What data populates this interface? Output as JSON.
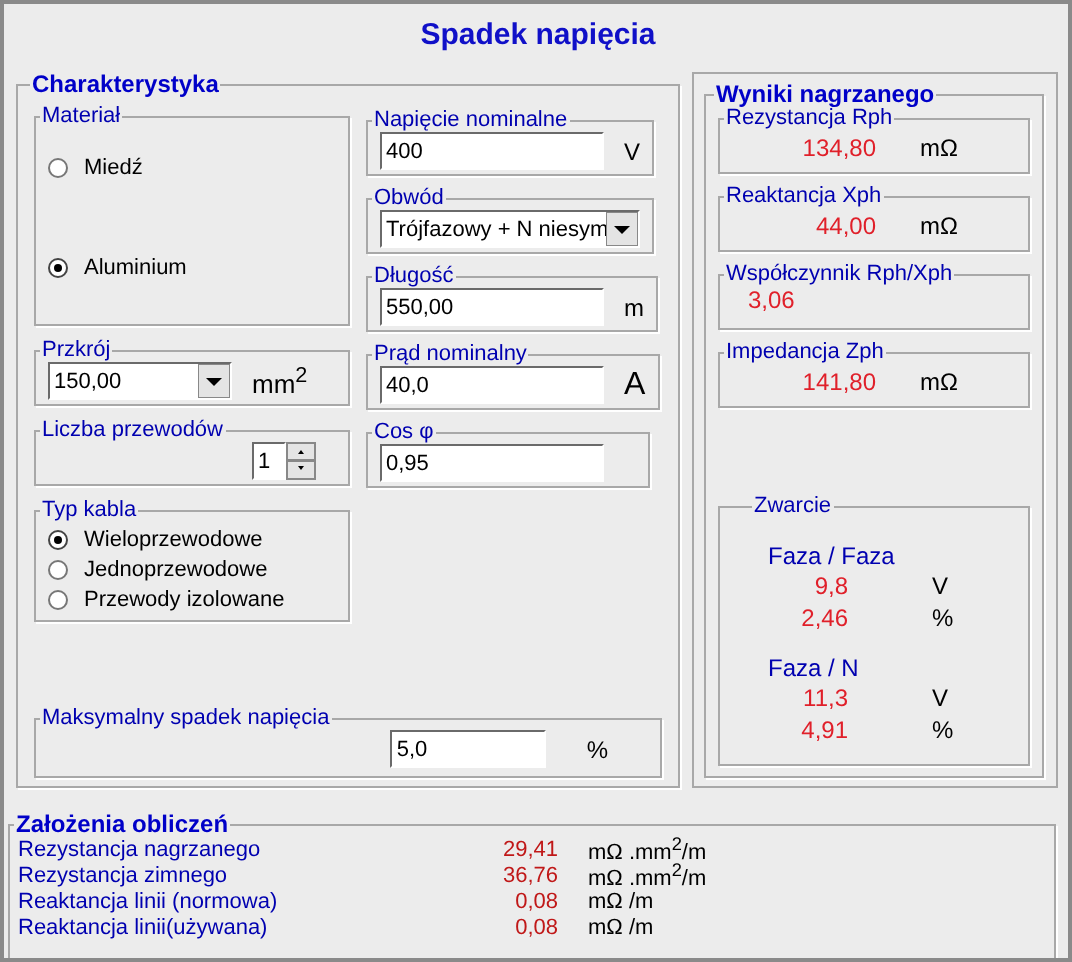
{
  "title": "Spadek napięcia",
  "characteristics": {
    "title": "Charakterystyka",
    "material": {
      "label": "Materiał",
      "options": [
        {
          "label": "Miedź",
          "selected": false
        },
        {
          "label": "Aluminium",
          "selected": true
        }
      ]
    },
    "cross_section": {
      "label": "Przkrój",
      "value": "150,00",
      "unit": "mm$^{2}$"
    },
    "conductors": {
      "label": "Liczba przewodów",
      "value": "1"
    },
    "cable_type": {
      "label": "Typ kabla",
      "options": [
        {
          "label": "Wieloprzewodowe",
          "selected": true
        },
        {
          "label": "Jednoprzewodowe",
          "selected": false
        },
        {
          "label": "Przewody izolowane",
          "selected": false
        }
      ]
    },
    "voltage": {
      "label": "Napięcie nominalne",
      "value": "400",
      "unit": "V"
    },
    "circuit": {
      "label": "Obwód",
      "value": "Trójfazowy + N niesym"
    },
    "length": {
      "label": "Długość",
      "value": "550,00",
      "unit": "m"
    },
    "current": {
      "label": "Prąd nominalny",
      "value": "40,0",
      "unit": "A"
    },
    "cos_phi": {
      "label": "Cos φ",
      "value": "0,95"
    },
    "max_drop": {
      "label": "Maksymalny spadek napięcia",
      "value": "5,0",
      "unit": "%"
    }
  },
  "results": {
    "title": "Wyniki nagrzanego",
    "items": [
      {
        "label": "Rezystancja Rph",
        "value": "134,80",
        "unit": "mΩ"
      },
      {
        "label": "Reaktancja Xph",
        "value": "44,00",
        "unit": "mΩ"
      },
      {
        "label": "Współczynnik Rph/Xph",
        "value": "3,06"
      },
      {
        "label": "Impedancja Zph",
        "value": "141,80",
        "unit": "mΩ"
      }
    ],
    "short_circuit": {
      "label": "Zwarcie",
      "groups": [
        {
          "label": "Faza / Faza",
          "rows": [
            {
              "value": "9,8",
              "unit": "V"
            },
            {
              "value": "2,46",
              "unit": "%"
            }
          ]
        },
        {
          "label": "Faza / N",
          "rows": [
            {
              "value": "11,3",
              "unit": "V"
            },
            {
              "value": "4,91",
              "unit": "%"
            }
          ]
        }
      ]
    }
  },
  "assumptions": {
    "title": "Założenia obliczeń",
    "rows": [
      {
        "label": "Rezystancja nagrzanego",
        "value": "29,41",
        "unit": "mΩ .mm$^{2}$/m"
      },
      {
        "label": "Rezystancja zimnego",
        "value": "36,76",
        "unit": "mΩ .mm$^{2}$/m"
      },
      {
        "label": "Reaktancja linii (normowa)",
        "value": "0,08",
        "unit": "mΩ /m"
      },
      {
        "label": "Reaktancja linii(używana)",
        "value": "0,08",
        "unit": "mΩ /m"
      }
    ]
  }
}
